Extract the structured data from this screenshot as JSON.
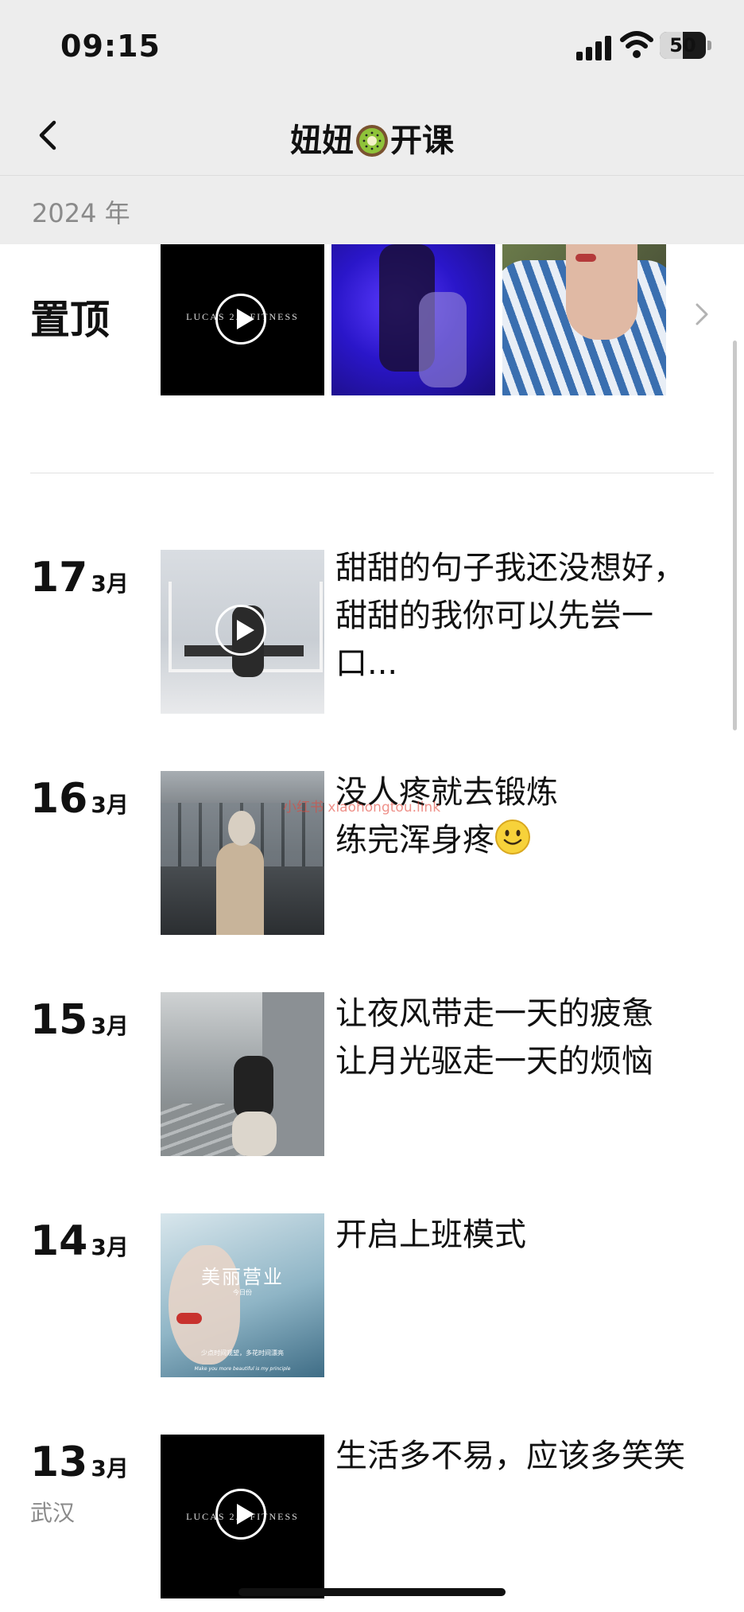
{
  "status_bar": {
    "time": "09:15",
    "battery_level": "50"
  },
  "nav": {
    "title_before": "妞妞",
    "title_emoji": "kiwi-emoji",
    "title_after": "开课"
  },
  "timeline": {
    "year": "2024 年",
    "pinned_label": "置顶",
    "pinned_thumbnails": [
      {
        "kind": "video",
        "overlay_text": "LUCAS 2.0 FITNESS"
      },
      {
        "kind": "photo",
        "overlay_text": ""
      },
      {
        "kind": "photo",
        "overlay_text": ""
      }
    ],
    "posts": [
      {
        "day": "17",
        "month": "3月",
        "location": "",
        "kind": "video",
        "caption": "甜甜的句子我还没想好，甜甜的我你可以先尝一口..."
      },
      {
        "day": "16",
        "month": "3月",
        "location": "",
        "kind": "photo",
        "caption_line1": "没人疼就去锻炼",
        "caption_line2": "练完浑身疼",
        "emoji": "slightly-smiling-face"
      },
      {
        "day": "15",
        "month": "3月",
        "location": "",
        "kind": "photo",
        "caption_line1": "让夜风带走一天的疲惫",
        "caption_line2": "让月光驱走一天的烦恼"
      },
      {
        "day": "14",
        "month": "3月",
        "location": "",
        "kind": "photo",
        "caption": "开启上班模式",
        "thumb_title": "美丽营业",
        "thumb_small1": "今日份",
        "thumb_small2": "少点时间观望，多花时间漂亮",
        "thumb_small3": "Make you more beautiful is my principle"
      },
      {
        "day": "13",
        "month": "3月",
        "location": "武汉",
        "kind": "video",
        "caption": "生活多不易，应该多笑笑",
        "thumb_overlay": "LUCAS 2.0 FITNESS"
      }
    ],
    "watermark": "小红书 xiaohongtou.link"
  },
  "colors": {
    "header_bg": "#ededed",
    "text": "#111111",
    "muted": "#8a8a8a",
    "divider": "#e2e2e2"
  }
}
